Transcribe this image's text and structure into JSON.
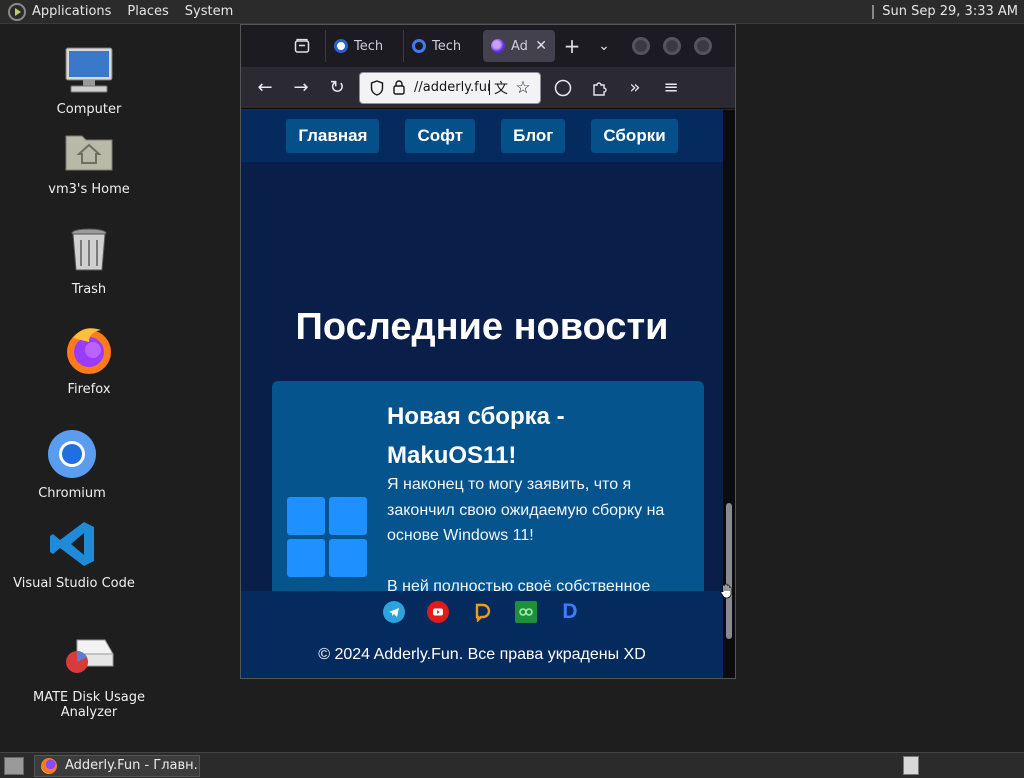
{
  "top_panel": {
    "menus": [
      "Applications",
      "Places",
      "System"
    ],
    "clock": "Sun Sep 29,  3:33 AM"
  },
  "desktop_icons": [
    {
      "label": "Computer",
      "icon": "computer-icon"
    },
    {
      "label": "vm3's Home",
      "icon": "home-folder-icon"
    },
    {
      "label": "Trash",
      "icon": "trash-icon"
    },
    {
      "label": "Firefox",
      "icon": "firefox-icon"
    },
    {
      "label": "Chromium",
      "icon": "chromium-icon"
    },
    {
      "label": "Visual Studio Code",
      "icon": "vscode-icon"
    },
    {
      "label": "MATE Disk Usage Analyzer",
      "icon": "disk-usage-icon"
    }
  ],
  "browser": {
    "tabs": [
      {
        "title": "Tech",
        "active": false
      },
      {
        "title": "Tech",
        "active": false
      },
      {
        "title": "Ad",
        "active": true
      }
    ],
    "url": "//adderly.fun/i"
  },
  "site": {
    "nav": [
      "Главная",
      "Софт",
      "Блог",
      "Сборки"
    ],
    "heading": "Последние новости",
    "card": {
      "title": "Новая сборка - MakuOS11!",
      "text": "Я наконец то могу заявить, что я закончил свою ожидаемую сборку на основе Windows 11!\n\nВ ней полностью своё собственное"
    },
    "footer": {
      "social_icons": [
        "telegram-icon",
        "youtube-icon",
        "donationalerts-icon",
        "boosty-icon",
        "d-icon"
      ],
      "copyright": "© 2024 Adderly.Fun. Все права украдены XD"
    }
  },
  "taskbar": {
    "window_title": "Adderly.Fun - Главн..."
  },
  "colors": {
    "page_bg": "#0a1e4a",
    "nav_bg": "#052a5e",
    "button_bg": "#06508a",
    "card_bg": "#05548e",
    "windows_logo": "#1e90ff"
  }
}
